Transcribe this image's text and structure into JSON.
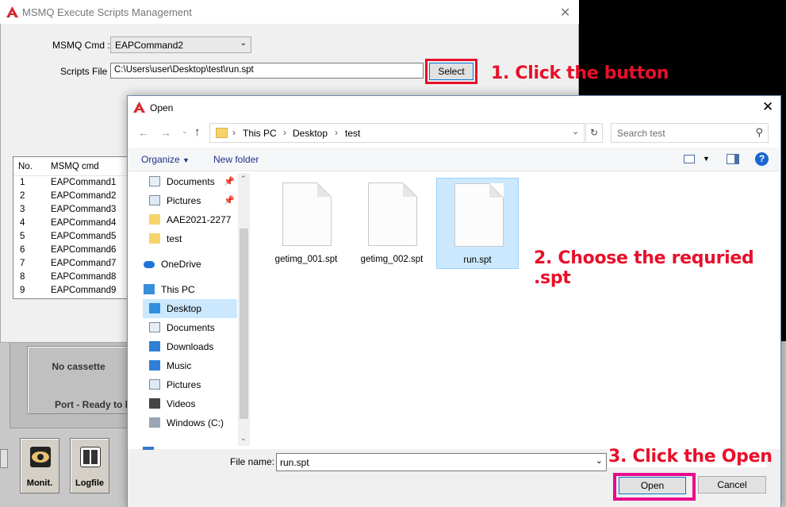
{
  "msmq_window": {
    "title": "MSMQ Execute Scripts Management",
    "cmd_label": "MSMQ Cmd :",
    "cmd_value": "EAPCommand2",
    "scripts_label": "Scripts File :",
    "scripts_value": "C:\\Users\\user\\Desktop\\test\\run.spt",
    "select_label": "Select",
    "list_headers": [
      "No.",
      "MSMQ cmd"
    ],
    "list_rows": [
      [
        "1",
        "EAPCommand1"
      ],
      [
        "2",
        "EAPCommand2"
      ],
      [
        "3",
        "EAPCommand3"
      ],
      [
        "4",
        "EAPCommand4"
      ],
      [
        "5",
        "EAPCommand5"
      ],
      [
        "6",
        "EAPCommand6"
      ],
      [
        "7",
        "EAPCommand7"
      ],
      [
        "8",
        "EAPCommand8"
      ],
      [
        "9",
        "EAPCommand9"
      ]
    ]
  },
  "background_app": {
    "cassette_status": "No cassette",
    "port_status": "Port - Ready to lo",
    "monit_label": "Monit.",
    "logfile_label": "Logfile"
  },
  "open_dialog": {
    "title": "Open",
    "breadcrumb": [
      "This PC",
      "Desktop",
      "test"
    ],
    "search_placeholder": "Search test",
    "organize_label": "Organize",
    "new_folder_label": "New folder",
    "sidebar": [
      {
        "label": "Documents",
        "icon": "documents-icon",
        "pinned": true
      },
      {
        "label": "Pictures",
        "icon": "pictures-icon",
        "pinned": true
      },
      {
        "label": "AAE2021-2277",
        "icon": "folder-icon"
      },
      {
        "label": "test",
        "icon": "folder-icon"
      },
      {
        "label": "OneDrive",
        "icon": "onedrive-icon"
      },
      {
        "label": "This PC",
        "icon": "pc-icon"
      },
      {
        "label": "Desktop",
        "icon": "desktop-icon",
        "selected": true
      },
      {
        "label": "Documents",
        "icon": "documents-icon"
      },
      {
        "label": "Downloads",
        "icon": "downloads-icon"
      },
      {
        "label": "Music",
        "icon": "music-icon"
      },
      {
        "label": "Pictures",
        "icon": "pictures-icon"
      },
      {
        "label": "Videos",
        "icon": "videos-icon"
      },
      {
        "label": "Windows (C:)",
        "icon": "drive-icon"
      }
    ],
    "files": [
      {
        "name": "getimg_001.spt"
      },
      {
        "name": "getimg_002.spt"
      },
      {
        "name": "run.spt",
        "selected": true
      }
    ],
    "file_name_label": "File name:",
    "file_name_value": "run.spt",
    "open_label": "Open",
    "cancel_label": "Cancel"
  },
  "annotations": {
    "step1": "1. Click the button",
    "step2": "2. Choose the requried .spt",
    "step3": "3. Click the Open",
    "accent_red": "#e8102a",
    "accent_pink": "#ea0a8c"
  }
}
